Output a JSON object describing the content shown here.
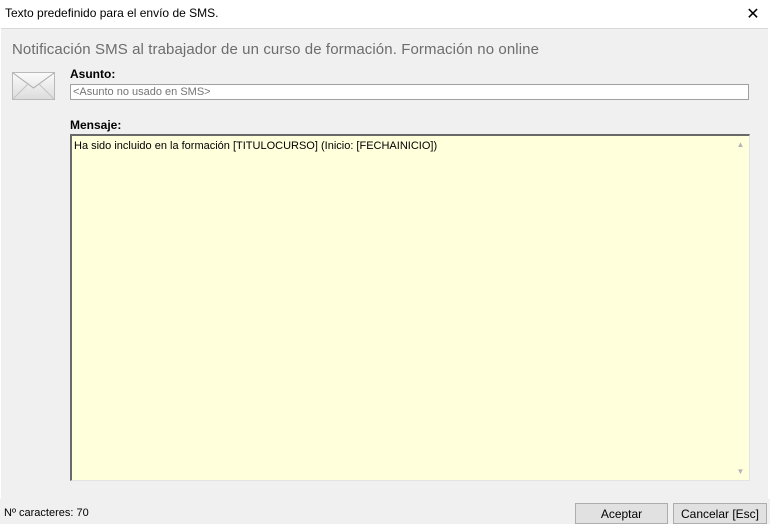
{
  "window": {
    "title": "Texto predefinido para el envío de SMS.",
    "close_glyph": "✕"
  },
  "header": {
    "heading": "Notificación SMS al trabajador de un curso de formación. Formación no online",
    "icon": "envelope-icon"
  },
  "form": {
    "asunto_label": "Asunto:",
    "asunto_placeholder": "<Asunto no usado en SMS>",
    "asunto_value": "",
    "mensaje_label": "Mensaje:",
    "mensaje_value": "Ha sido incluido en la formación [TITULOCURSO] (Inicio: [FECHAINICIO])"
  },
  "footer": {
    "char_count": "Nº caracteres: 70",
    "accept_label": "Aceptar",
    "cancel_label": "Cancelar [Esc]"
  },
  "colors": {
    "message_background": "#ffffdc",
    "client_background": "#f0f0f0",
    "heading_text": "#6d6d6d"
  }
}
